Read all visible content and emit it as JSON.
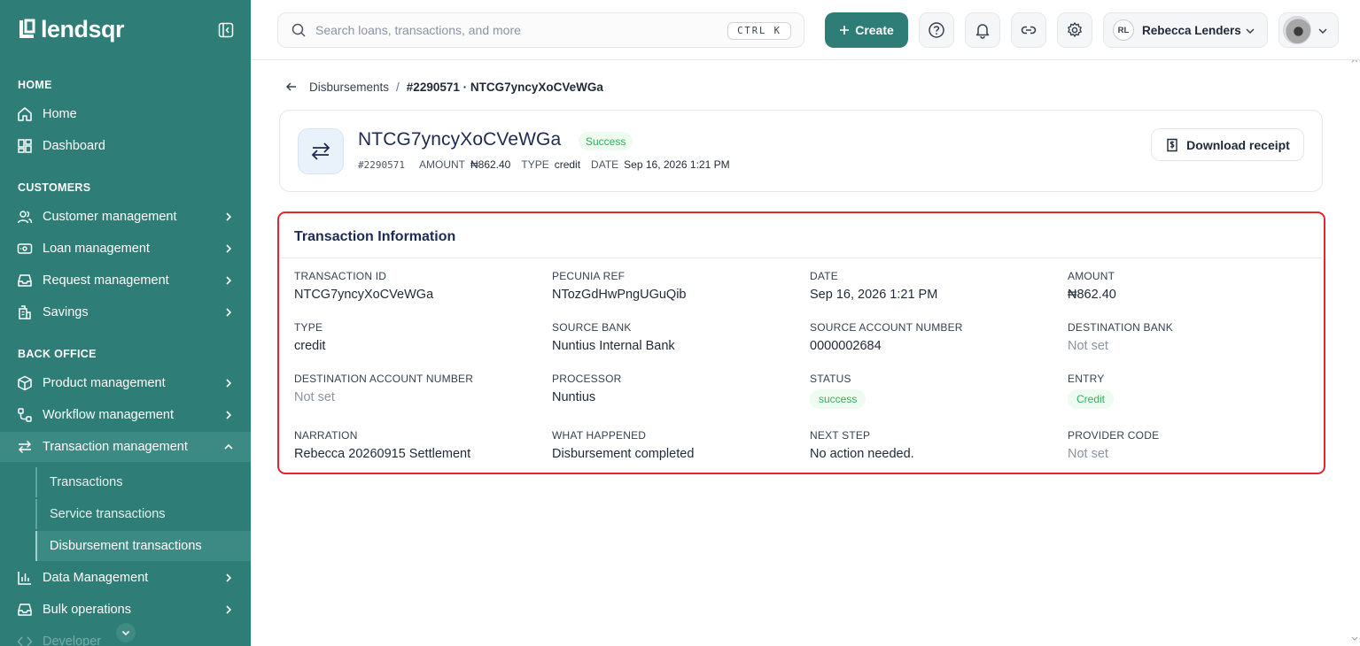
{
  "brand": {
    "name": "lendsqr"
  },
  "sidebar": {
    "sections": {
      "home": "HOME",
      "customers": "CUSTOMERS",
      "back_office": "BACK OFFICE"
    },
    "items": {
      "home": "Home",
      "dashboard": "Dashboard",
      "customer_management": "Customer management",
      "loan_management": "Loan management",
      "request_management": "Request management",
      "savings": "Savings",
      "product_management": "Product management",
      "workflow_management": "Workflow management",
      "transaction_management": "Transaction management",
      "data_management": "Data Management",
      "bulk_operations": "Bulk operations",
      "developer": "Developer"
    },
    "sub_items": {
      "transactions": "Transactions",
      "service_transactions": "Service transactions",
      "disbursement_transactions": "Disbursement transactions"
    }
  },
  "header": {
    "search_placeholder": "Search loans, transactions, and more",
    "shortcut": "CTRL K",
    "create_label": "Create",
    "org_initials": "RL",
    "org_name": "Rebecca Lenders"
  },
  "breadcrumb": {
    "parent": "Disbursements",
    "separator": "/",
    "current": "#2290571 · NTCG7yncyXoCVeWGa"
  },
  "summary": {
    "title": "NTCG7yncyXoCVeWGa",
    "status": "Success",
    "id": "#2290571",
    "amount_label": "AMOUNT",
    "amount": "₦862.40",
    "type_label": "TYPE",
    "type": "credit",
    "date_label": "DATE",
    "date": "Sep 16, 2026 1:21 PM",
    "download_label": "Download receipt"
  },
  "info": {
    "title": "Transaction Information",
    "fields": [
      {
        "label": "TRANSACTION ID",
        "value": "NTCG7yncyXoCVeWGa"
      },
      {
        "label": "PECUNIA REF",
        "value": "NTozGdHwPngUGuQib"
      },
      {
        "label": "DATE",
        "value": "Sep 16, 2026 1:21 PM"
      },
      {
        "label": "AMOUNT",
        "value": "₦862.40"
      },
      {
        "label": "TYPE",
        "value": "credit"
      },
      {
        "label": "SOURCE BANK",
        "value": "Nuntius Internal Bank"
      },
      {
        "label": "SOURCE ACCOUNT NUMBER",
        "value": "0000002684"
      },
      {
        "label": "DESTINATION BANK",
        "value": "Not set"
      },
      {
        "label": "DESTINATION ACCOUNT NUMBER",
        "value": "Not set"
      },
      {
        "label": "PROCESSOR",
        "value": "Nuntius"
      },
      {
        "label": "STATUS",
        "value": "success"
      },
      {
        "label": "ENTRY",
        "value": "Credit"
      },
      {
        "label": "NARRATION",
        "value": "Rebecca 20260915 Settlement"
      },
      {
        "label": "WHAT HAPPENED",
        "value": "Disbursement completed"
      },
      {
        "label": "NEXT STEP",
        "value": "No action needed."
      },
      {
        "label": "PROVIDER CODE",
        "value": "Not set"
      }
    ]
  },
  "colors": {
    "primary": "#2e7d76",
    "sidebar_active": "#3c8a83",
    "success_text": "#34b15a",
    "success_bg": "#eefbf1",
    "highlight_border": "#e8242e"
  }
}
